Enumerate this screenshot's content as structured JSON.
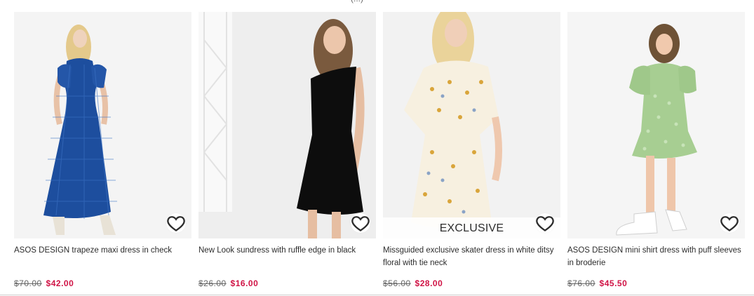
{
  "top_fragment": "(...)",
  "products": [
    {
      "title": "ASOS DESIGN trapeze maxi dress in check",
      "old_price": "$70.00",
      "new_price": "$42.00",
      "badge": ""
    },
    {
      "title": "New Look sundress with ruffle edge in black",
      "old_price": "$26.00",
      "new_price": "$16.00",
      "badge": ""
    },
    {
      "title": "Missguided exclusive skater dress in white ditsy floral with tie neck",
      "old_price": "$56.00",
      "new_price": "$28.00",
      "badge": "EXCLUSIVE"
    },
    {
      "title": "ASOS DESIGN mini shirt dress with puff sleeves in broderie",
      "old_price": "$76.00",
      "new_price": "$45.50",
      "badge": ""
    }
  ],
  "colors": {
    "sale_price": "#d01345",
    "text": "#2d2d2d",
    "strikethrough": "#666666"
  },
  "icons": {
    "save": "heart-outline-icon"
  }
}
